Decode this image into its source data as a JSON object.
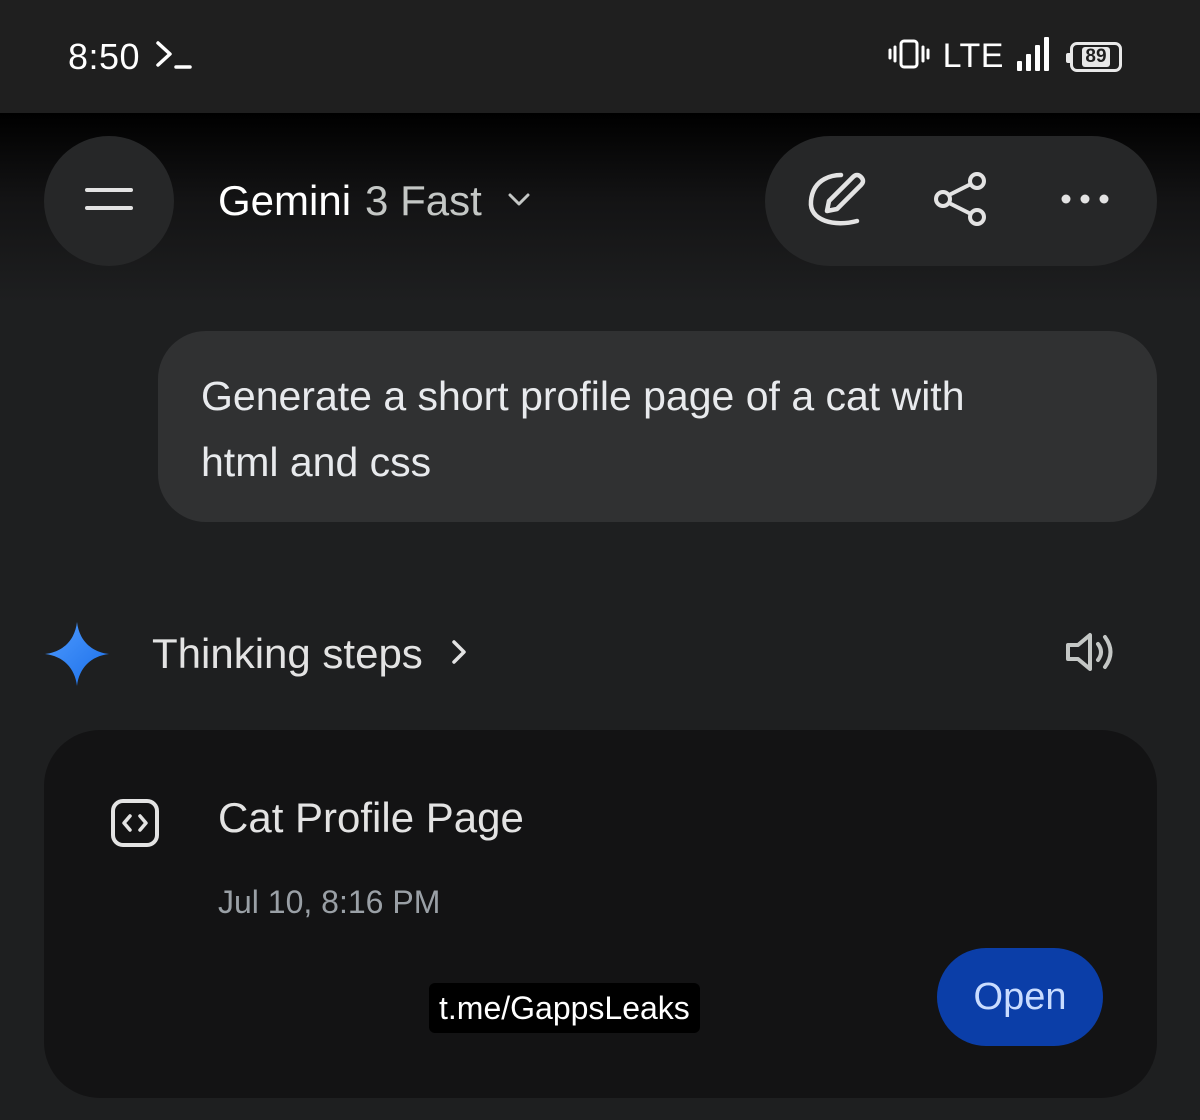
{
  "status_bar": {
    "time": "8:50",
    "network": "LTE",
    "battery": "89",
    "terminal_icon": "terminal-prompt-icon",
    "vibrate_icon": "vibrate-icon",
    "signal_icon": "signal-bars-icon"
  },
  "header": {
    "model_name": "Gemini",
    "model_variant": "3 Fast",
    "icons": {
      "menu": "menu-icon",
      "dropdown": "chevron-down-icon",
      "new_chat": "edit-icon",
      "share": "share-icon",
      "more": "more-horizontal-icon"
    }
  },
  "conversation": {
    "user_message_line1": "Generate a short profile page of a cat with",
    "user_message_line2": "html and css",
    "response": {
      "thinking_label": "Thinking steps",
      "icons": {
        "spark": "gemini-spark-icon",
        "expand": "chevron-right-icon",
        "read_aloud": "speaker-icon"
      },
      "canvas_card": {
        "title": "Cat Profile Page",
        "date": "Jul 10, 8:16 PM",
        "open_label": "Open",
        "icon": "code-icon"
      }
    }
  },
  "watermark": "t.me/GappsLeaks",
  "colors": {
    "background": "#1e1f20",
    "bubble": "#303132",
    "card": "#131314",
    "open_button": "#0b3ea8",
    "spark_start": "#4285f4",
    "spark_end": "#1a73e8"
  }
}
